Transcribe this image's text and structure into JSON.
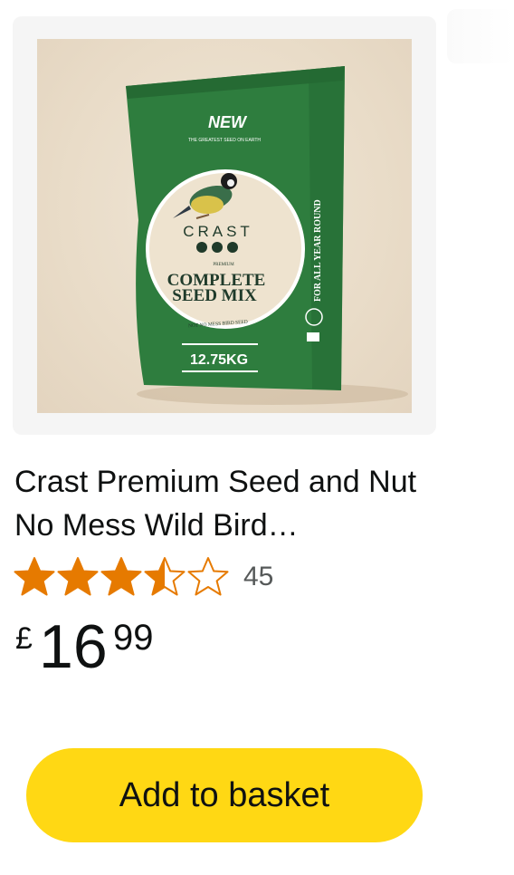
{
  "product": {
    "title": "Crast Premium Seed and Nut No Mess Wild Bird…",
    "rating": 3.5,
    "rating_max": 5,
    "rating_count": "45",
    "price": {
      "currency": "£",
      "whole": "16",
      "fraction": "99"
    },
    "add_to_basket_label": "Add to basket"
  },
  "bag": {
    "badge": "NEW",
    "tagline": "THE GREATEST SEED ON EARTH",
    "brand": "CRAST",
    "grade": "PREMIUM",
    "name_line1": "COMPLETE",
    "name_line2": "SEED MIX",
    "subtitle": "NOT NO MESS BIRD SEED",
    "side_text": "FOR ALL YEAR ROUND",
    "weight": "12.75KG"
  },
  "colors": {
    "star": "#e67a00",
    "button": "#ffd814",
    "bag_green": "#2e7d3e"
  }
}
